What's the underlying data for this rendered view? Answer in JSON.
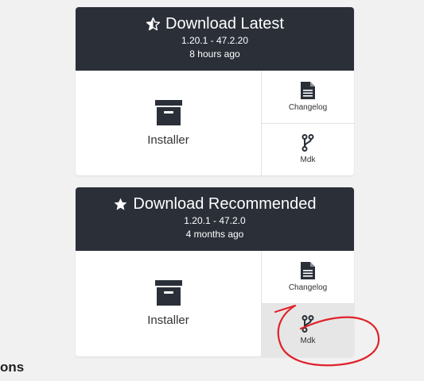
{
  "cards": [
    {
      "title": "Download Latest",
      "icon": "star-half-icon",
      "version": "1.20.1 - 47.2.20",
      "age": "8 hours ago",
      "installer_label": "Installer",
      "side": [
        {
          "label": "Changelog",
          "icon": "document-icon"
        },
        {
          "label": "Mdk",
          "icon": "branch-icon"
        }
      ]
    },
    {
      "title": "Download Recommended",
      "icon": "star-icon",
      "version": "1.20.1 - 47.2.0",
      "age": "4 months ago",
      "installer_label": "Installer",
      "side": [
        {
          "label": "Changelog",
          "icon": "document-icon"
        },
        {
          "label": "Mdk",
          "icon": "branch-icon"
        }
      ]
    }
  ],
  "section_heading_partial": "ons",
  "colors": {
    "header_bg": "#2a2f38",
    "page_bg": "#f1f1f1",
    "highlight_bg": "#e6e6e6",
    "annotation_red": "#e0222a"
  }
}
